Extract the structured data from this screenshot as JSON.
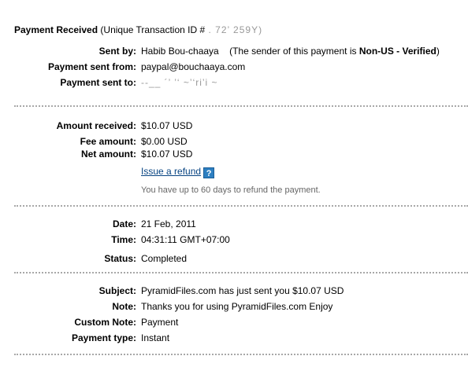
{
  "header": {
    "title": "Payment Received",
    "transaction_prefix": "(Unique Transaction ID #",
    "transaction_masked": " .  72’            259Y)"
  },
  "sender": {
    "sent_by_label": "Sent by:",
    "sent_by_name": "Habib Bou-chaaya",
    "sent_by_note_prefix": "(The sender of this payment is",
    "sent_by_status": "Non-US - Verified",
    "sent_by_note_suffix": ")",
    "sent_from_label": "Payment sent from:",
    "sent_from_value": "paypal@bouchaaya.com",
    "sent_to_label": "Payment sent to:",
    "sent_to_masked": "--__   ´’ ’‘  ~’‘ri’i  ~"
  },
  "amounts": {
    "received_label": "Amount received:",
    "received_value": "$10.07 USD",
    "fee_label": "Fee amount:",
    "fee_value": "$0.00 USD",
    "net_label": "Net amount:",
    "net_value": "$10.07 USD",
    "refund_link": "Issue a refund",
    "help_glyph": "?",
    "refund_note": "You have up to 60 days to refund the payment."
  },
  "details": {
    "date_label": "Date:",
    "date_value": "21 Feb, 2011",
    "time_label": "Time:",
    "time_value": "04:31:11 GMT+07:00",
    "status_label": "Status:",
    "status_value": "Completed"
  },
  "message": {
    "subject_label": "Subject:",
    "subject_value": "PyramidFiles.com has just sent you $10.07 USD",
    "note_label": "Note:",
    "note_value": "Thanks you for using PyramidFiles.com Enjoy",
    "custom_note_label": "Custom Note:",
    "custom_note_value": "Payment",
    "payment_type_label": "Payment type:",
    "payment_type_value": "Instant"
  },
  "colors": {
    "link": "#084482",
    "help_icon": "#2d7fc1",
    "muted_text": "#666666",
    "divider": "#a8a8a8"
  }
}
